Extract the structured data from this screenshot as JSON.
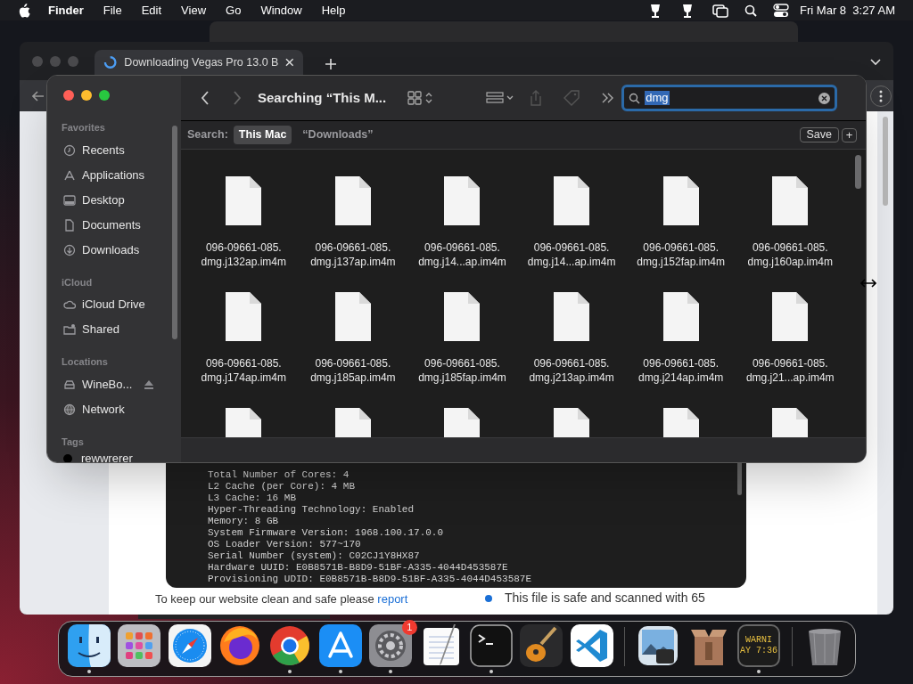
{
  "menu_bar": {
    "app": "Finder",
    "menus": [
      "File",
      "Edit",
      "View",
      "Go",
      "Window",
      "Help"
    ],
    "clock": "Fri Mar 8  3:27 AM"
  },
  "browser": {
    "tab_title": "Downloading Vegas Pro 13.0 B",
    "terminal_lines": [
      "Total Number of Cores: 4",
      "L2 Cache (per Core): 4 MB",
      "L3 Cache: 16 MB",
      "Hyper-Threading Technology: Enabled",
      "Memory: 8 GB",
      "System Firmware Version: 1968.100.17.0.0",
      "OS Loader Version: 577~170",
      "Serial Number (system): C02CJ1Y8HX87",
      "Hardware UUID: E0B8571B-B8D9-51BF-A335-4044D453587E",
      "Provisioning UDID: E0B8571B-B8D9-51BF-A335-4044D453587E"
    ],
    "notice": "To keep our website clean and safe please",
    "notice_link": "report",
    "safe_note": "This file is safe and scanned with 65"
  },
  "finder": {
    "title": "Searching “This M...",
    "search_query": "dmg",
    "search_label": "Search:",
    "scopes": [
      {
        "label": "This Mac",
        "selected": true
      },
      {
        "label": "“Downloads”",
        "selected": false
      }
    ],
    "save": "Save",
    "add": "+",
    "sidebar": [
      {
        "heading": "Favorites",
        "items": [
          {
            "label": "Recents",
            "kind": "clock"
          },
          {
            "label": "Applications",
            "kind": "apps"
          },
          {
            "label": "Desktop",
            "kind": "desktop"
          },
          {
            "label": "Documents",
            "kind": "document"
          },
          {
            "label": "Downloads",
            "kind": "download"
          }
        ]
      },
      {
        "heading": "iCloud",
        "items": [
          {
            "label": "iCloud Drive",
            "kind": "cloud"
          },
          {
            "label": "Shared",
            "kind": "shared"
          }
        ]
      },
      {
        "heading": "Locations",
        "items": [
          {
            "label": "WineBo...",
            "kind": "drive"
          },
          {
            "label": "Network",
            "kind": "globe"
          }
        ]
      },
      {
        "heading": "Tags",
        "items": [
          {
            "label": "rewwrerer",
            "kind": "tag",
            "color": "#000000"
          }
        ]
      }
    ],
    "files": [
      {
        "name": "096-09661-085.\ndmg.j132ap.im4m"
      },
      {
        "name": "096-09661-085.\ndmg.j137ap.im4m"
      },
      {
        "name": "096-09661-085.\ndmg.j14...ap.im4m"
      },
      {
        "name": "096-09661-085.\ndmg.j14...ap.im4m"
      },
      {
        "name": "096-09661-085.\ndmg.j152fap.im4m"
      },
      {
        "name": "096-09661-085.\ndmg.j160ap.im4m"
      },
      {
        "name": "096-09661-085.\ndmg.j174ap.im4m"
      },
      {
        "name": "096-09661-085.\ndmg.j185ap.im4m"
      },
      {
        "name": "096-09661-085.\ndmg.j185fap.im4m"
      },
      {
        "name": "096-09661-085.\ndmg.j213ap.im4m"
      },
      {
        "name": "096-09661-085.\ndmg.j214ap.im4m"
      },
      {
        "name": "096-09661-085.\ndmg.j21...ap.im4m"
      }
    ],
    "cut_off_row": [
      {
        "kind": "document"
      },
      {
        "kind": "document"
      },
      {
        "kind": "document"
      },
      {
        "kind": "document"
      },
      {
        "kind": "document"
      },
      {
        "kind": "document"
      }
    ]
  },
  "dock": {
    "apps": [
      {
        "kind": "finder",
        "running": true
      },
      {
        "kind": "launchpad",
        "running": false
      },
      {
        "kind": "safari",
        "running": false
      },
      {
        "kind": "firefox",
        "running": false
      },
      {
        "kind": "chrome",
        "running": true
      },
      {
        "kind": "appstore",
        "running": true
      },
      {
        "kind": "settings",
        "running": true,
        "badge": "1"
      },
      {
        "kind": "textedit",
        "running": false
      },
      {
        "kind": "terminal",
        "running": true
      },
      {
        "kind": "guitar",
        "running": false
      },
      {
        "kind": "vscode",
        "running": false
      }
    ],
    "others": [
      {
        "kind": "preview",
        "running": false
      },
      {
        "kind": "archive",
        "running": false
      },
      {
        "kind": "console",
        "running": true,
        "lines": [
          "WARNI",
          "AY 7:36"
        ]
      },
      {
        "kind": "trash",
        "running": false
      }
    ]
  }
}
